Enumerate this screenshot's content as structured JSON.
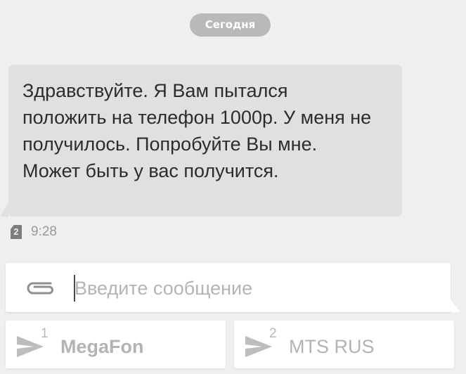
{
  "thread": {
    "date_label": "Сегодня",
    "message": {
      "text": "Здравствуйте. Я Вам пытался положить на телефон 1000р. У меня не получилось. Попробуйте Вы мне. Может быть у вас получится.",
      "sim_slot": "2",
      "time": "9:28",
      "sim_icon": "sim-card-icon"
    }
  },
  "composer": {
    "placeholder": "Введите сообщение",
    "value": "",
    "attach_icon": "paperclip-icon"
  },
  "send_buttons": [
    {
      "sim": "1",
      "label": "MegaFon",
      "icon": "send-arrow-icon"
    },
    {
      "sim": "2",
      "label": "MTS RUS",
      "icon": "send-arrow-icon"
    }
  ],
  "colors": {
    "background": "#efefef",
    "bubble": "#e0e0e0",
    "date_pill": "#b9b9b9",
    "disabled_text": "#b3b3b3"
  }
}
